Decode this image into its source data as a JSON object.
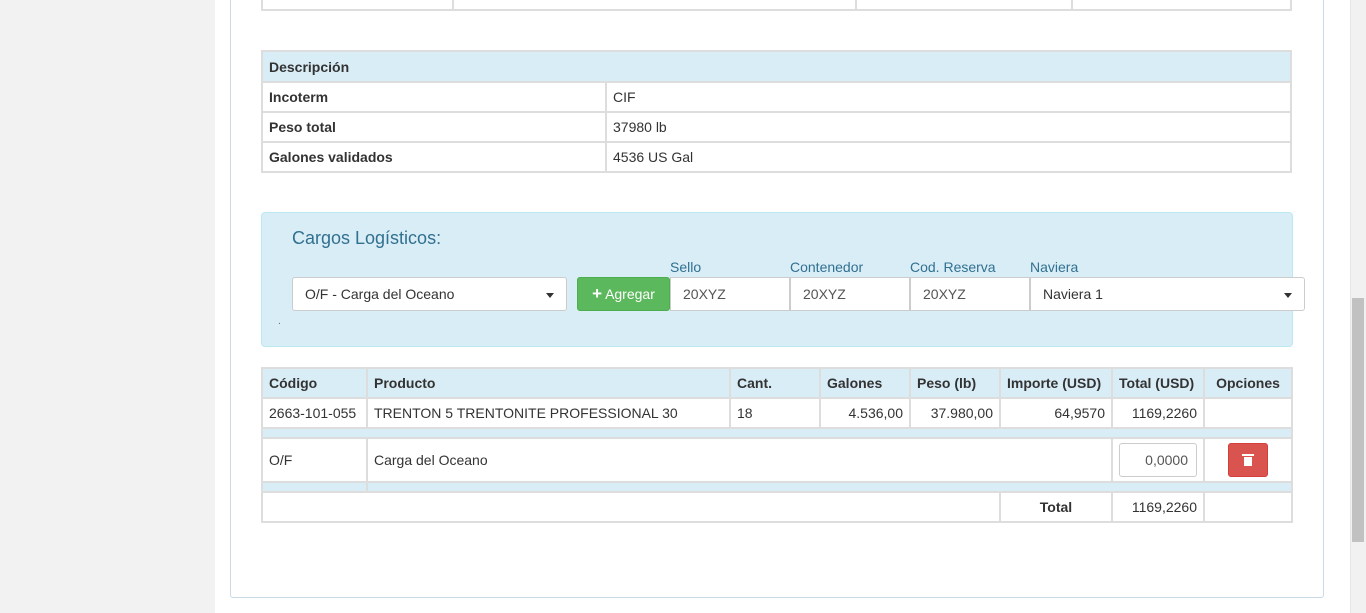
{
  "description_table": {
    "header": "Descripción",
    "rows": [
      {
        "key": "Incoterm",
        "value": "CIF"
      },
      {
        "key": "Peso total",
        "value": "37980 lb"
      },
      {
        "key": "Galones validados",
        "value": "4536 US Gal"
      }
    ]
  },
  "cargos": {
    "title": "Cargos Logísticos:",
    "charge_select": "O/F - Carga del Oceano",
    "add_button": "Agregar",
    "labels": {
      "sello": "Sello",
      "contenedor": "Contenedor",
      "cod_reserva": "Cod. Reserva",
      "naviera": "Naviera"
    },
    "values": {
      "sello": "20XYZ",
      "contenedor": "20XYZ",
      "cod_reserva": "20XYZ",
      "naviera": "Naviera 1"
    },
    "dot": "."
  },
  "product_table": {
    "headers": [
      "Código",
      "Producto",
      "Cant.",
      "Galones",
      "Peso (lb)",
      "Importe (USD)",
      "Total (USD)",
      "Opciones"
    ],
    "row": {
      "codigo": "2663-101-055",
      "producto": "TRENTON 5 TRENTONITE PROFESSIONAL 30",
      "cant": "18",
      "galones": "4.536,00",
      "peso": "37.980,00",
      "importe": "64,9570",
      "total": "1169,2260"
    },
    "charge": {
      "codigo": "O/F",
      "descripcion": "Carga del Oceano",
      "amount": "0,0000"
    },
    "total_label": "Total",
    "total_value": "1169,2260"
  },
  "colors": {
    "info_bg": "#d9edf7",
    "success": "#5cb85c",
    "danger": "#d9534f",
    "info_text": "#31708f"
  }
}
